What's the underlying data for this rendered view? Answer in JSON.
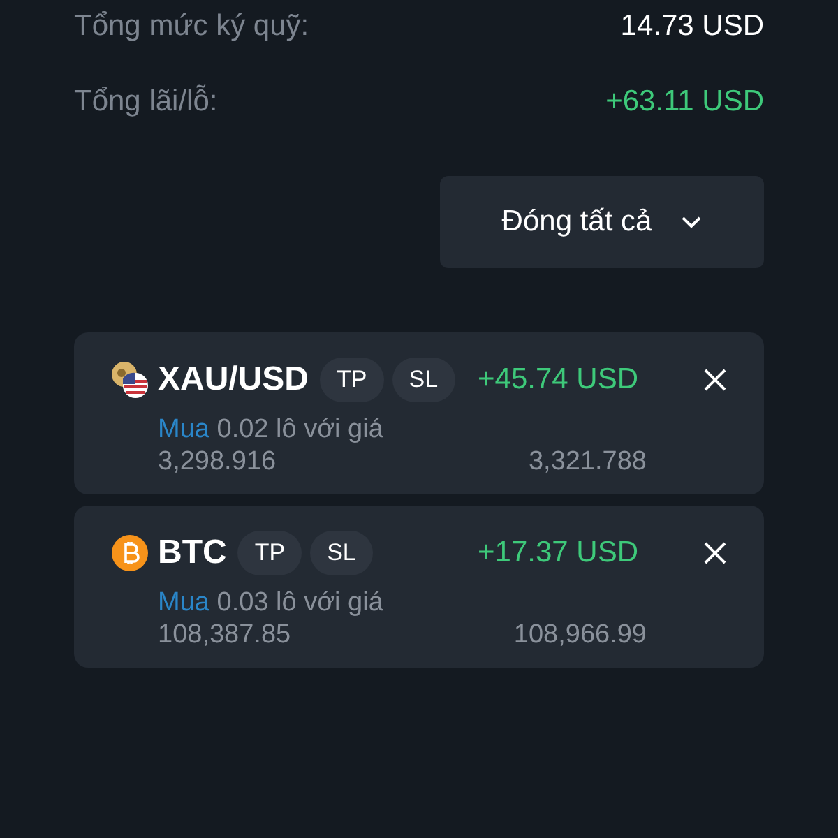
{
  "summary": [
    {
      "label": "Tổng mức ký quỹ:",
      "value": "14.73 USD",
      "kind": "neutral"
    },
    {
      "label": "Tổng lãi/lỗ:",
      "value": "+63.11 USD",
      "kind": "profit"
    }
  ],
  "close_all": {
    "label": "Đóng tất cả"
  },
  "positions": [
    {
      "symbol": "XAU/USD",
      "kind": "commodity",
      "tp": "TP",
      "sl": "SL",
      "pnl": "+45.74 USD",
      "side": "Mua",
      "detail": "0.02 lô với giá 3,298.916",
      "current": "3,321.788"
    },
    {
      "symbol": "BTC",
      "kind": "crypto",
      "tp": "TP",
      "sl": "SL",
      "pnl": "+17.37 USD",
      "side": "Mua",
      "detail": "0.03 lô với giá 108,387.85",
      "current": "108,966.99"
    }
  ]
}
